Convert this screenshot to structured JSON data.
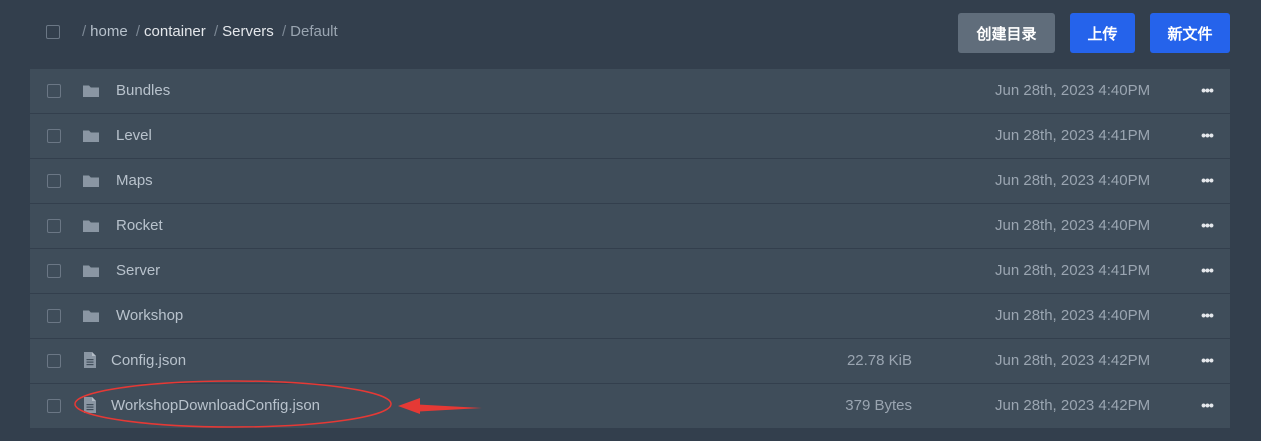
{
  "breadcrumb": {
    "separator": "/",
    "crumbs": [
      "home",
      "container",
      "Servers",
      "Default"
    ]
  },
  "buttons": {
    "create_dir": "创建目录",
    "upload": "上传",
    "new_file": "新文件"
  },
  "colors": {
    "background": "#333f4d",
    "row": "#3f4d5a",
    "primary": "#2563eb",
    "secondary": "#606d7b",
    "annotation": "#e53935"
  },
  "files": [
    {
      "type": "folder",
      "icon": "folder-icon",
      "name": "Bundles",
      "size": "",
      "date": "Jun 28th, 2023 4:40PM"
    },
    {
      "type": "folder",
      "icon": "folder-icon",
      "name": "Level",
      "size": "",
      "date": "Jun 28th, 2023 4:41PM"
    },
    {
      "type": "folder",
      "icon": "folder-icon",
      "name": "Maps",
      "size": "",
      "date": "Jun 28th, 2023 4:40PM"
    },
    {
      "type": "folder",
      "icon": "folder-icon",
      "name": "Rocket",
      "size": "",
      "date": "Jun 28th, 2023 4:40PM"
    },
    {
      "type": "folder",
      "icon": "folder-icon",
      "name": "Server",
      "size": "",
      "date": "Jun 28th, 2023 4:41PM"
    },
    {
      "type": "folder",
      "icon": "folder-icon",
      "name": "Workshop",
      "size": "",
      "date": "Jun 28th, 2023 4:40PM"
    },
    {
      "type": "file",
      "icon": "file-icon",
      "name": "Config.json",
      "size": "22.78 KiB",
      "date": "Jun 28th, 2023 4:42PM"
    },
    {
      "type": "file",
      "icon": "file-icon",
      "name": "WorkshopDownloadConfig.json",
      "size": "379 Bytes",
      "date": "Jun 28th, 2023 4:42PM"
    }
  ],
  "more_label": "•••"
}
